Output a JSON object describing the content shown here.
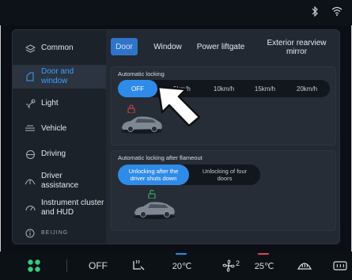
{
  "status": {
    "icons": [
      "bluetooth-icon",
      "wifi-icon"
    ]
  },
  "sidebar": {
    "items": [
      {
        "label": "Common",
        "icon": "layers-icon"
      },
      {
        "label": "Door and window",
        "icon": "door-icon"
      },
      {
        "label": "Light",
        "icon": "light-icon"
      },
      {
        "label": "Vehicle",
        "icon": "vehicle-icon"
      },
      {
        "label": "Driving",
        "icon": "steering-icon"
      },
      {
        "label": "Driver assistance",
        "icon": "assist-icon"
      },
      {
        "label": "Instrument cluster and HUD",
        "icon": "gauge-icon"
      },
      {
        "label": "BEIJING",
        "icon": "info-icon"
      }
    ],
    "active_index": 1
  },
  "tabs": [
    "Door",
    "Window",
    "Power liftgate",
    "Exterior rearview mirror"
  ],
  "active_tab": 0,
  "auto_lock": {
    "title": "Automatic  locking",
    "options": [
      "OFF",
      "5km/h",
      "10km/h",
      "15km/h",
      "20km/h"
    ],
    "selected": 0
  },
  "auto_lock_flameout": {
    "title": "Automatic locking after flameout",
    "options": [
      "Unlocking after the driver shuts down",
      "Unlocking of four doors"
    ],
    "selected": 0
  },
  "bottom_bar": {
    "fan_label": "OFF",
    "left_temp": "20℃",
    "fan_level": "2",
    "right_temp": "25℃"
  },
  "colors": {
    "accent": "#2f8be8",
    "active_text": "#3aa0ff",
    "lock_red": "#e0444a",
    "unlock_green": "#33c26b"
  }
}
